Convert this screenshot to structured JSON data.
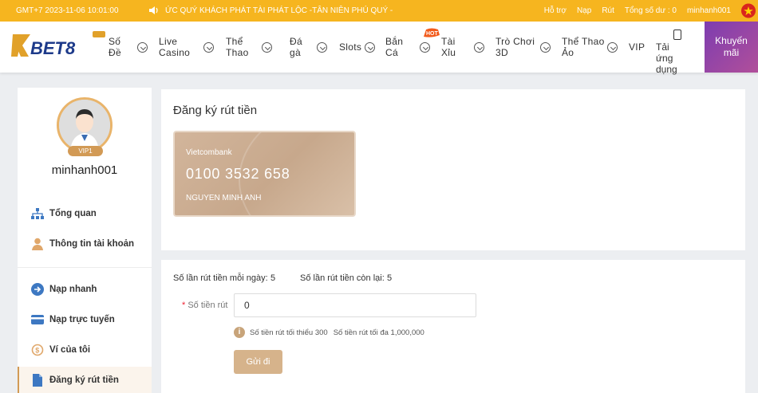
{
  "topbar": {
    "clock": "GMT+7 2023-11-06 10:01:00",
    "marquee": "ỨC QUÝ KHÁCH PHÁT TÀI PHÁT LỘC -TÂN NIÊN PHÚ QUÝ -",
    "links": {
      "support": "Hỗ trợ",
      "deposit": "Nạp",
      "withdraw": "Rút",
      "balance": "Tổng số dư : 0",
      "user": "minhanh001"
    }
  },
  "nav": {
    "logo": "BET8",
    "items": [
      {
        "label": "Số\nĐề"
      },
      {
        "label": "Live\nCasino"
      },
      {
        "label": "Thể\nThao"
      },
      {
        "label": "Đá\ngà"
      },
      {
        "label": "Slots"
      },
      {
        "label": "Bắn\nCá"
      },
      {
        "label": "Tài\nXỉu"
      },
      {
        "label": "Trò Chơi\n3D"
      },
      {
        "label": "Thể Thao\nẢo"
      },
      {
        "label": "VIP"
      }
    ],
    "app_label": "Tải ứng\ndụng",
    "promo_label": "Khuyến\nmãi",
    "hot_badge": "HOT"
  },
  "sidebar": {
    "vip": "VIP1",
    "username": "minhanh001",
    "items": [
      {
        "label": "Tổng quan"
      },
      {
        "label": "Thông tin tài khoản"
      },
      {
        "label": "Nạp nhanh"
      },
      {
        "label": "Nạp trực tuyến"
      },
      {
        "label": "Ví của tôi"
      },
      {
        "label": "Đăng ký rút tiền"
      }
    ]
  },
  "main": {
    "title": "Đăng ký rút tiền",
    "card": {
      "bank": "Vietcombank",
      "number": "0100  3532  658",
      "holder": "NGUYEN MINH ANH"
    },
    "quota": {
      "daily_label": "Số lần rút tiền mỗi ngày:",
      "daily_value": "5",
      "remaining_label": "Số lần rút tiền còn lại:",
      "remaining_value": "5"
    },
    "amount_label": "Số tiền rút",
    "amount_value": "0",
    "hint_min": "Số tiền rút tối thiểu 300",
    "hint_max": "Số tiền rút tối đa 1,000,000",
    "submit_label": "Gửi đi"
  },
  "colors": {
    "topbar": "#f6b51f",
    "accent": "#d6b38b",
    "promo": "#8b42aa"
  }
}
